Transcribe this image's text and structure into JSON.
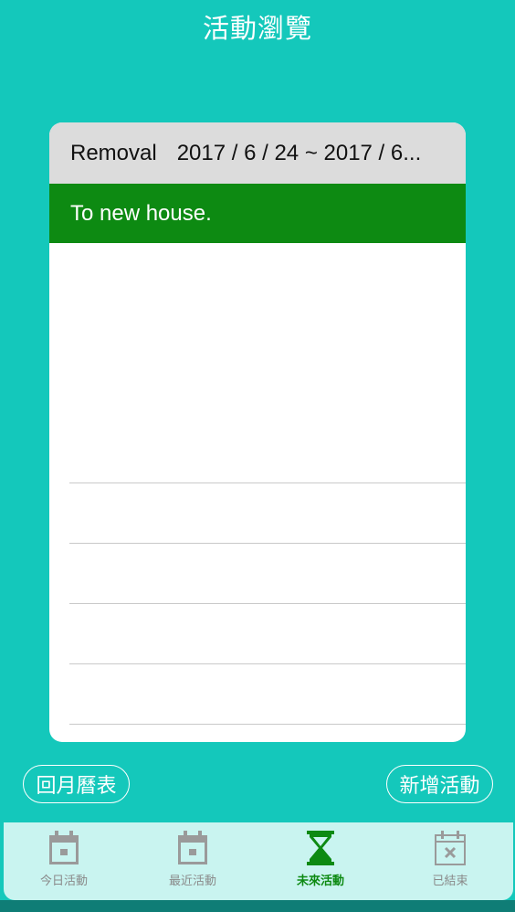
{
  "header": {
    "title": "活動瀏覽"
  },
  "event": {
    "name": "Removal",
    "dates": "2017 / 6 / 24 ~ 2017 / 6...",
    "description": "To new house."
  },
  "buttons": {
    "back_to_calendar": "回月曆表",
    "add_event": "新增活動"
  },
  "tabs": [
    {
      "label": "今日活動",
      "icon": "calendar-icon",
      "active": false
    },
    {
      "label": "最近活動",
      "icon": "calendar-icon",
      "active": false
    },
    {
      "label": "未來活動",
      "icon": "hourglass-icon",
      "active": true
    },
    {
      "label": "已結束",
      "icon": "calendar-x-icon",
      "active": false
    }
  ],
  "colors": {
    "background": "#14c8bb",
    "header_row": "#dcdcdc",
    "description_row": "#0d8a12",
    "tabbar": "#c9f4f0",
    "active_tab": "#0d8a12",
    "inactive_tab": "#8a8a8a"
  }
}
